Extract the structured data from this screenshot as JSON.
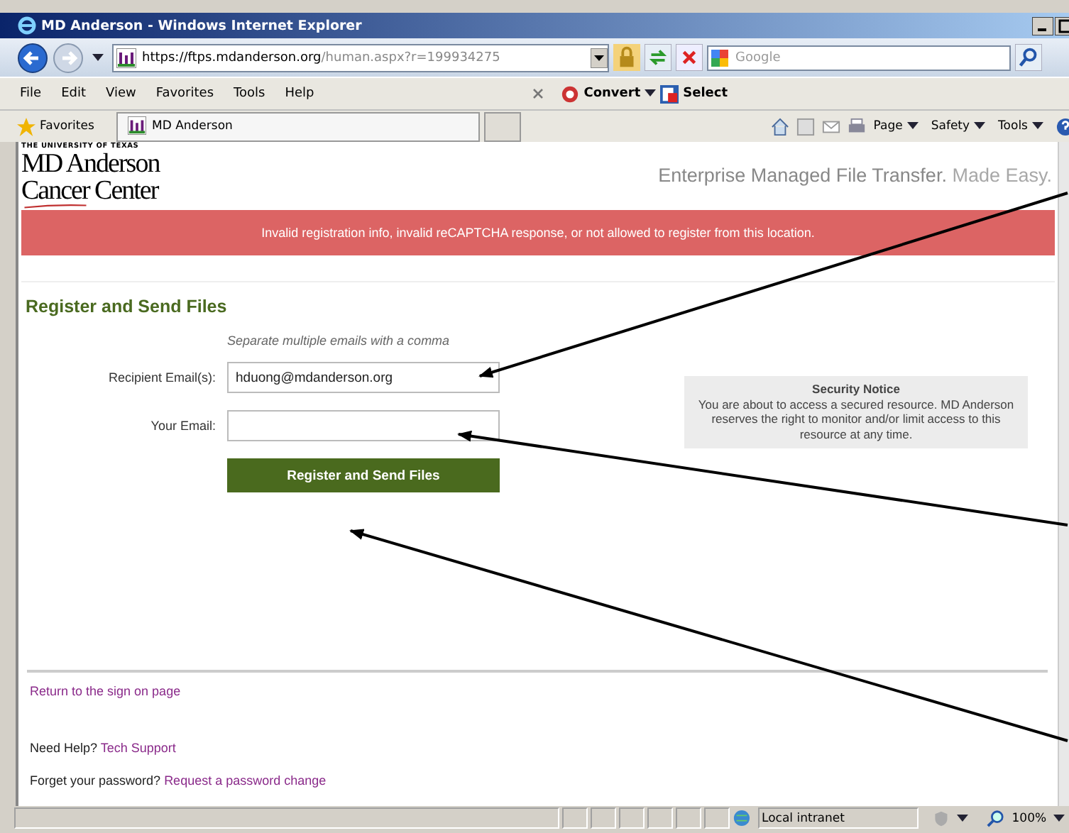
{
  "window": {
    "title": "MD Anderson - Windows Internet Explorer"
  },
  "address_bar": {
    "scheme": "https://",
    "host": "ftps.mdanderson.org",
    "path": "/human.aspx?r=199934275"
  },
  "search": {
    "placeholder": "Google"
  },
  "menu": [
    "File",
    "Edit",
    "View",
    "Favorites",
    "Tools",
    "Help"
  ],
  "toolbar_buttons": [
    "Convert",
    "Select"
  ],
  "favorites": {
    "label": "Favorites",
    "tab": "MD Anderson"
  },
  "command_bar": [
    "Page",
    "Safety",
    "Tools"
  ],
  "page": {
    "logo": {
      "line_1": "THE UNIVERSITY OF TEXAS",
      "line_2": "MD Anderson",
      "line_3": "Cancer Center"
    },
    "tagline": {
      "main": "Enterprise Managed File Transfer.",
      "faded": "Made Easy."
    },
    "error": "Invalid registration info, invalid reCAPTCHA response, or not allowed to register from this location.",
    "heading": "Register and Send Files",
    "hint": "Separate multiple emails with a comma",
    "fields": [
      {
        "label": "Recipient Email(s):",
        "value": "hduong@mdanderson.org"
      },
      {
        "label": "Your Email:"
      }
    ],
    "submit": "Register and Send Files",
    "notice": {
      "title": "Security Notice",
      "body": "You are about to access a secured resource. MD Anderson reserves the right to monitor and/or limit access to this resource at any time."
    },
    "return_link": "Return to the sign on page",
    "help": {
      "text": "Need Help?",
      "link": "Tech Support"
    },
    "password": {
      "text": "Forget your password?",
      "link": "Request a password change"
    }
  },
  "status_bar": {
    "zone": "Local intranet",
    "zoom": "100%"
  }
}
